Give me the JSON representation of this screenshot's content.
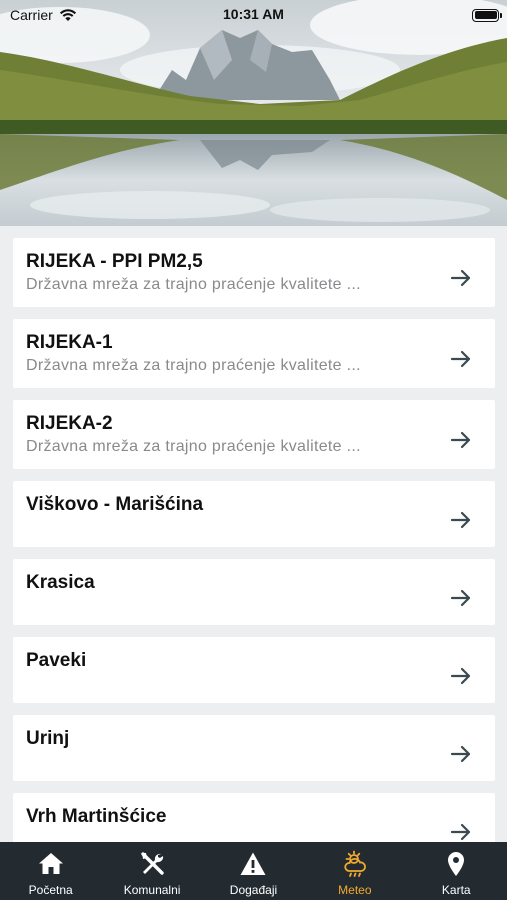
{
  "status_bar": {
    "carrier": "Carrier",
    "time": "10:31 AM"
  },
  "stations": [
    {
      "title": "RIJEKA - PPI PM2,5",
      "subtitle": "Državna mreža za trajno praćenje kvalitete ..."
    },
    {
      "title": "RIJEKA-1",
      "subtitle": "Državna mreža za trajno praćenje kvalitete ..."
    },
    {
      "title": "RIJEKA-2",
      "subtitle": "Državna mreža za trajno praćenje kvalitete ..."
    },
    {
      "title": "Viškovo - Marišćina",
      "subtitle": ""
    },
    {
      "title": "Krasica",
      "subtitle": ""
    },
    {
      "title": "Paveki",
      "subtitle": ""
    },
    {
      "title": "Urinj",
      "subtitle": ""
    },
    {
      "title": "Vrh Martinšćice",
      "subtitle": ""
    }
  ],
  "tabs": [
    {
      "label": "Početna",
      "icon": "home-icon"
    },
    {
      "label": "Komunalni",
      "icon": "tools-icon"
    },
    {
      "label": "Događaji",
      "icon": "warning-icon"
    },
    {
      "label": "Meteo",
      "icon": "weather-icon",
      "active": true
    },
    {
      "label": "Karta",
      "icon": "map-pin-icon"
    }
  ],
  "colors": {
    "tabbar_bg": "#232b31",
    "active_tab": "#f2a92d",
    "arrow": "#3b4a50",
    "list_bg": "#eceef0"
  }
}
